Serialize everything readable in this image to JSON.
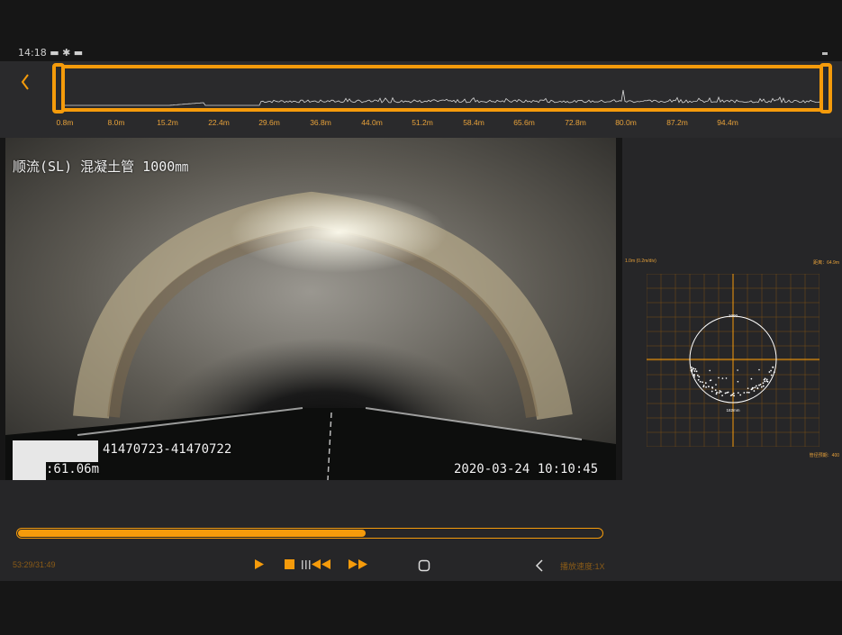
{
  "status_bar": {
    "text": "14:18 ▬ ✱ ▬"
  },
  "timeline": {
    "back_icon": "chevron-left-icon",
    "ticks": [
      "0.8m",
      "8.0m",
      "15.2m",
      "22.4m",
      "29.6m",
      "36.8m",
      "44.0m",
      "51.2m",
      "58.4m",
      "65.6m",
      "72.8m",
      "80.0m",
      "87.2m",
      "94.4m"
    ],
    "accent_color": "#f59b0b"
  },
  "video": {
    "overlay_title": "顺流(SL) 混凝土管  1000㎜",
    "overlay_id": "41470723-41470722",
    "overlay_distance": ":61.06m",
    "overlay_datetime": "2020-03-24 10:10:45"
  },
  "side_panel": {
    "scale_label": "1.0m (0.2m/div)",
    "top_right_label": "距离：64.9m",
    "bottom_right_label": "管径预期：400",
    "chart_circle_label": "1000",
    "chart_bottom_label": "182mm"
  },
  "playback": {
    "progress": 0.595,
    "time": "53:29/31:49",
    "speed": "播放速度:1X",
    "play_icon": "play-icon",
    "stop_icon": "stop-icon",
    "frame_back_icon": "frame-back-icon",
    "fast_forward_icon": "fast-forward-icon"
  },
  "system_nav": {
    "home_icon": "home-icon",
    "back_icon": "back-icon"
  }
}
